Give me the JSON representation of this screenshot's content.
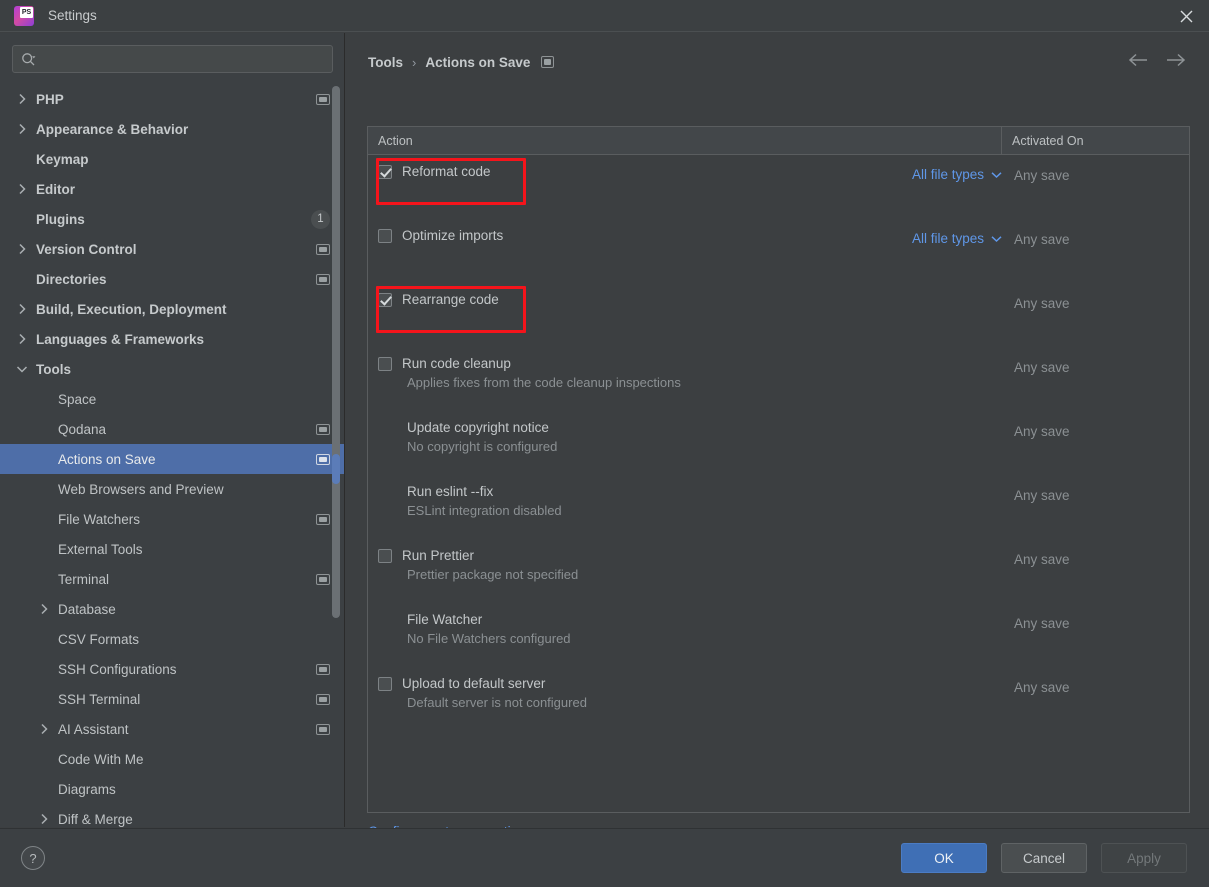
{
  "window": {
    "title": "Settings",
    "logo_icon": "phpstorm-logo",
    "logo_text": "PS",
    "close_icon": "close-icon"
  },
  "sidebar": {
    "search": {
      "placeholder": "",
      "value": "",
      "icon": "search-icon"
    },
    "items": [
      {
        "label": "PHP",
        "level": 0,
        "arrow": "right",
        "bold": true,
        "badge": "module"
      },
      {
        "label": "Appearance & Behavior",
        "level": 0,
        "arrow": "right",
        "bold": true
      },
      {
        "label": "Keymap",
        "level": 0,
        "arrow": "none",
        "bold": true
      },
      {
        "label": "Editor",
        "level": 0,
        "arrow": "right",
        "bold": true
      },
      {
        "label": "Plugins",
        "level": 0,
        "arrow": "none",
        "bold": true,
        "count": "1"
      },
      {
        "label": "Version Control",
        "level": 0,
        "arrow": "right",
        "bold": true,
        "badge": "module"
      },
      {
        "label": "Directories",
        "level": 0,
        "arrow": "none",
        "bold": true,
        "badge": "module"
      },
      {
        "label": "Build, Execution, Deployment",
        "level": 0,
        "arrow": "right",
        "bold": true
      },
      {
        "label": "Languages & Frameworks",
        "level": 0,
        "arrow": "right",
        "bold": true
      },
      {
        "label": "Tools",
        "level": 0,
        "arrow": "down",
        "bold": true
      },
      {
        "label": "Space",
        "level": 1,
        "arrow": "none"
      },
      {
        "label": "Qodana",
        "level": 1,
        "arrow": "none",
        "badge": "module"
      },
      {
        "label": "Actions on Save",
        "level": 1,
        "arrow": "none",
        "badge": "module",
        "selected": true
      },
      {
        "label": "Web Browsers and Preview",
        "level": 1,
        "arrow": "none"
      },
      {
        "label": "File Watchers",
        "level": 1,
        "arrow": "none",
        "badge": "module"
      },
      {
        "label": "External Tools",
        "level": 1,
        "arrow": "none"
      },
      {
        "label": "Terminal",
        "level": 1,
        "arrow": "none",
        "badge": "module"
      },
      {
        "label": "Database",
        "level": 1,
        "arrow": "right"
      },
      {
        "label": "CSV Formats",
        "level": 1,
        "arrow": "none"
      },
      {
        "label": "SSH Configurations",
        "level": 1,
        "arrow": "none",
        "badge": "module"
      },
      {
        "label": "SSH Terminal",
        "level": 1,
        "arrow": "none",
        "badge": "module"
      },
      {
        "label": "AI Assistant",
        "level": 1,
        "arrow": "right",
        "badge": "module"
      },
      {
        "label": "Code With Me",
        "level": 1,
        "arrow": "none"
      },
      {
        "label": "Diagrams",
        "level": 1,
        "arrow": "none"
      },
      {
        "label": "Diff & Merge",
        "level": 1,
        "arrow": "right"
      }
    ]
  },
  "main": {
    "breadcrumb": {
      "parent": "Tools",
      "separator": "›",
      "current": "Actions on Save",
      "badge": "module"
    },
    "nav": {
      "back_icon": "arrow-left-icon",
      "forward_icon": "arrow-right-icon"
    },
    "table": {
      "columns": [
        "Action",
        "Activated On"
      ],
      "rows": [
        {
          "title": "Reformat code",
          "checkbox": "checked",
          "file_types": "All file types",
          "activated": "Any save",
          "highlight": true
        },
        {
          "title": "Optimize imports",
          "checkbox": "unchecked",
          "file_types": "All file types",
          "activated": "Any save"
        },
        {
          "title": "Rearrange code",
          "checkbox": "checked",
          "activated": "Any save",
          "highlight": true
        },
        {
          "title": "Run code cleanup",
          "checkbox": "unchecked",
          "description": "Applies fixes from the code cleanup inspections",
          "activated": "Any save"
        },
        {
          "title": "Update copyright notice",
          "checkbox": "none",
          "description": "No copyright is configured",
          "activated": "Any save"
        },
        {
          "title": "Run eslint --fix",
          "checkbox": "none",
          "description": "ESLint integration disabled",
          "activated": "Any save"
        },
        {
          "title": "Run Prettier",
          "checkbox": "unchecked",
          "description": "Prettier package not specified",
          "activated": "Any save"
        },
        {
          "title": "File Watcher",
          "checkbox": "none",
          "description": "No File Watchers configured",
          "activated": "Any save"
        },
        {
          "title": "Upload to default server",
          "checkbox": "unchecked",
          "description": "Default server is not configured",
          "activated": "Any save"
        }
      ]
    },
    "autosave_link": "Configure autosave options..."
  },
  "footer": {
    "help_label": "?",
    "ok_label": "OK",
    "cancel_label": "Cancel",
    "apply_label": "Apply"
  },
  "colors": {
    "selection_blue": "#4e6ea8",
    "link_blue": "#5f97e8",
    "highlight_red": "#f5141b",
    "primary_button": "#3f6fb5",
    "panel_bg": "#3c3f41",
    "sidebar_bg": "#3c4043"
  }
}
